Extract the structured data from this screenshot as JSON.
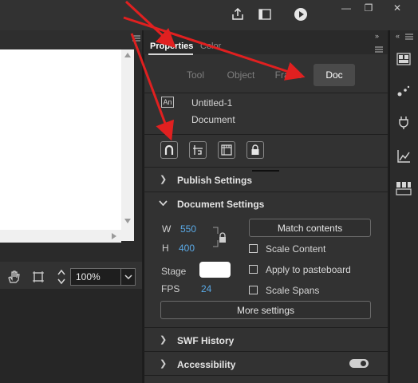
{
  "window": {
    "minimize": "—",
    "restore": "❐",
    "close": "✕"
  },
  "stage": {
    "zoom_value": "100%"
  },
  "panel": {
    "tabs": [
      "Properties",
      "Color"
    ],
    "mode_tabs": [
      "Tool",
      "Object",
      "Frame",
      "Doc"
    ],
    "doc_icon_text": "An",
    "doc_name": "Untitled-1",
    "doc_type": "Document",
    "publish_settings": "Publish Settings",
    "document_settings": "Document Settings",
    "width_label": "W",
    "width_value": "550",
    "height_label": "H",
    "height_value": "400",
    "match_contents": "Match contents",
    "scale_content": "Scale Content",
    "stage_label": "Stage",
    "apply_to_pasteboard": "Apply to pasteboard",
    "fps_label": "FPS",
    "fps_value": "24",
    "scale_spans": "Scale Spans",
    "more_settings": "More settings",
    "swf_history": "SWF History",
    "accessibility": "Accessibility"
  },
  "colors": {
    "accent": "#5aa9e6",
    "annotation_arrow": "#e02020",
    "stage_color": "#ffffff"
  }
}
